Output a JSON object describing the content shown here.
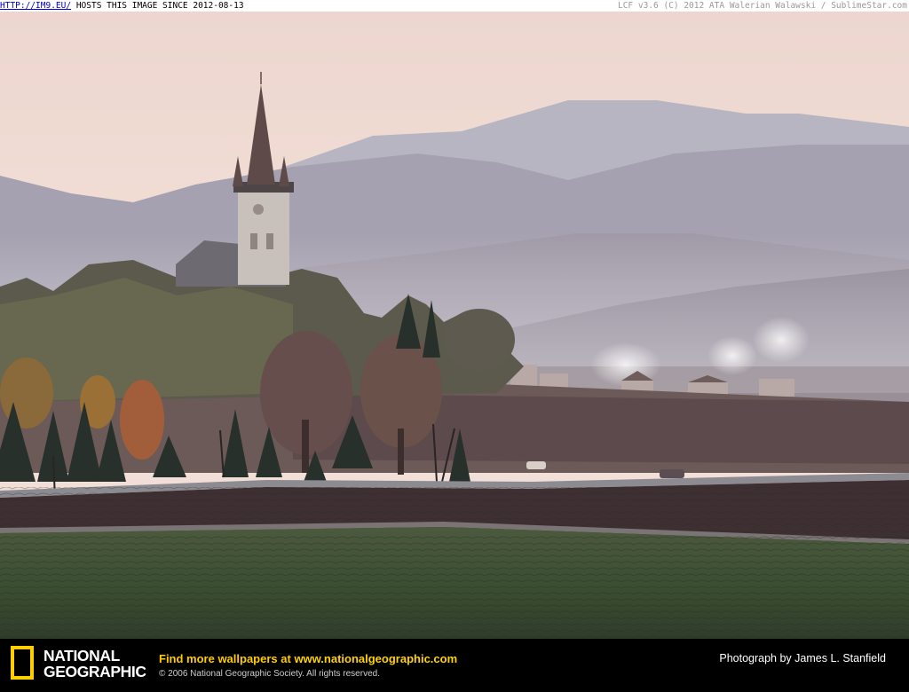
{
  "top_bar": {
    "link_text": "HTTP://IM9.EU/",
    "hosts_text": "HOSTS THIS IMAGE SINCE 2012-08-13",
    "credit_text": "LCF v3.6 (C) 2012 ATA Walerian Walawski / SublimeStar.com"
  },
  "footer": {
    "logo_line1": "NATIONAL",
    "logo_line2": "GEOGRAPHIC",
    "promo_prefix": "Find more wallpapers at ",
    "promo_url": "www.nationalgeographic.com",
    "copyright": "© 2006 National Geographic Society. All rights reserved.",
    "photo_credit": "Photograph by James L. Stanfield"
  },
  "colors": {
    "accent_yellow": "#ffce00",
    "sky": "#f2d8cf",
    "field_green": "#3e5234"
  }
}
